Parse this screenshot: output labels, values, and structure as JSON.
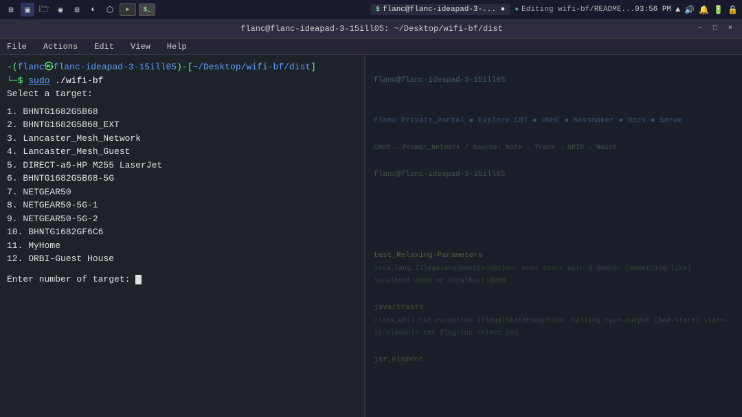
{
  "taskbar": {
    "time": "03:56 PM",
    "terminal_tab": "flanc@flanc-ideapad-3-... ●",
    "editor_tab": "Editing wifi-bf/README...",
    "icons": [
      "file-manager",
      "browser",
      "terminal",
      "text-editor"
    ]
  },
  "title_bar": {
    "title": "flanc@flanc-ideapad-3-15ill05: ~/Desktop/wifi-bf/dist",
    "minimize": "−",
    "maximize": "□",
    "close": "×"
  },
  "menu_bar": {
    "items": [
      "File",
      "Actions",
      "Edit",
      "View",
      "Help"
    ]
  },
  "terminal": {
    "prompt_user": "flanc",
    "prompt_host": "flanc-ideapad-3-15ill05",
    "prompt_path": "~/Desktop/wifi-bf/dist",
    "prompt_symbol": ")",
    "cmd_sudo": "sudo",
    "cmd_rest": " ./wifi-bf",
    "select_label": "Select a target:",
    "networks": [
      "1. BHNTG1682G5B68",
      "2. BHNTG1682G5B68_EXT",
      "3. Lancaster_Mesh_Network",
      "4. Lancaster_Mesh_Guest",
      "5. DIRECT-a6-HP M255 LaserJet",
      "6. BHNTG1682G5B68-5G",
      "7. NETGEAR50",
      "8. NETGEAR50-5G-1",
      "9. NETGEAR50-5G-2",
      "10. BHNTG1682GF6C6",
      "11. MyHome",
      "12. ORBI-Guest House"
    ],
    "enter_label": "Enter number of target: "
  },
  "right_pane": {
    "lines": [
      "",
      "flanc@flanc-ideapad-3-15ill05",
      "",
      "",
      "",
      "",
      "",
      "flanc@flanc-ideapad-3-15ill05",
      "",
      "",
      "",
      "",
      "",
      "",
      "test_Relaxing-Parameters",
      "java.lang.IllegalArgumentException: must start with a number (something like) localhost:8080 or localhost:8080",
      "",
      "java/traits",
      "class_util.txt.exception.IllegalStateException: Calling type-output (bad-state) state-is-elements-txt flag-inc-select seq.",
      "",
      "jar_element",
      ""
    ]
  }
}
